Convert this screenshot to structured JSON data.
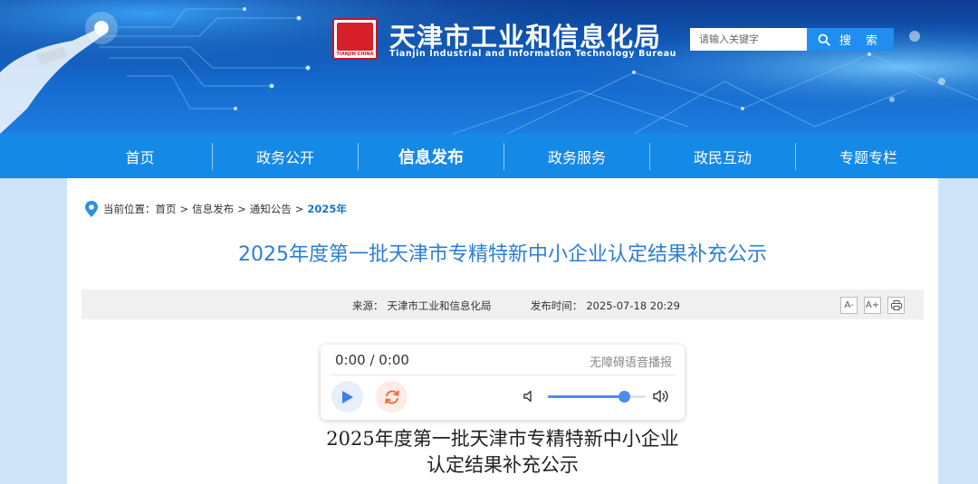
{
  "header": {
    "title": "天津市工业和信息化局",
    "subtitle": "Tianjin Industrial and Information Technology Bureau",
    "logo_text": "TIANJIN·CHINA",
    "search_placeholder": "请输入关键字",
    "search_label": "搜 索"
  },
  "nav": {
    "items": [
      {
        "label": "首页"
      },
      {
        "label": "政务公开"
      },
      {
        "label": "信息发布"
      },
      {
        "label": "政务服务"
      },
      {
        "label": "政民互动"
      },
      {
        "label": "专题专栏"
      }
    ],
    "active_index": 2
  },
  "breadcrumb": {
    "prefix": "当前位置：",
    "items": [
      "首页",
      "信息发布",
      "通知公告"
    ],
    "current": "2025年",
    "separator": ">"
  },
  "article": {
    "title": "2025年度第一批天津市专精特新中小企业认定结果补充公示",
    "source_label": "来源：",
    "source": "天津市工业和信息化局",
    "date_label": "发布时间：",
    "date": "2025-07-18 20:29",
    "tools": [
      "A-",
      "A+",
      "print"
    ],
    "body_title_line1": "2025年度第一批天津市专精特新中小企业",
    "body_title_line2": "认定结果补充公示"
  },
  "player": {
    "time": "0:00 / 0:00",
    "accessibility_label": "无障碍语音播报",
    "volume": 0.78
  },
  "colors": {
    "nav_bg": "#1589e6",
    "title_blue": "#2d7fd2",
    "accent": "#4c8bf5",
    "search_btn": "#1f8ef0"
  }
}
